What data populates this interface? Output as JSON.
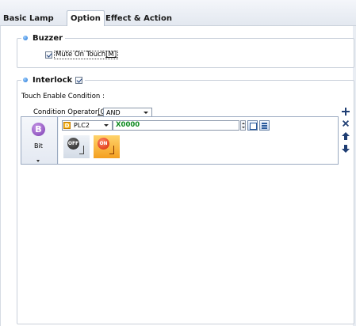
{
  "tabs": [
    {
      "label": "Basic",
      "active": false
    },
    {
      "label": "Lamp",
      "active": false
    },
    {
      "label": "Option",
      "active": true
    },
    {
      "label": "Effect & Action",
      "active": false
    }
  ],
  "buzzer": {
    "title": "Buzzer",
    "mute_label": "Mute On Touch",
    "mute_hotkey": "[M]",
    "mute_checked": true
  },
  "interlock": {
    "title": "Interlock",
    "checked": true,
    "touch_enable_label": "Touch Enable Condition :",
    "operator_label": "Condition Operator",
    "operator_hotkey": "[O]",
    "operator_suffix": " :",
    "operator_value": "AND",
    "condition": {
      "type_icon": "B",
      "type_label": "Bit",
      "plc_icon": "D",
      "plc": "PLC2",
      "address": "X0000",
      "states": [
        {
          "icon": "off-state-icon",
          "text": "OFF"
        },
        {
          "icon": "on-state-icon",
          "text": "ON"
        }
      ]
    },
    "side_buttons": [
      "add-icon",
      "delete-icon",
      "move-up-icon",
      "move-down-icon"
    ]
  },
  "colors": {
    "accent": "#1b6fd1",
    "address_text": "#0d8a1f",
    "bit_icon": "#7a3ab0",
    "on_state": "#f4a020"
  }
}
